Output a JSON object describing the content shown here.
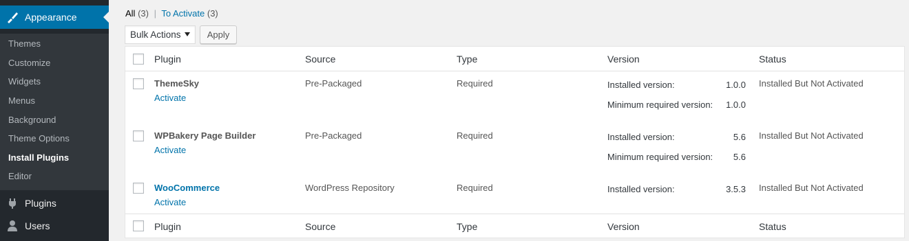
{
  "sidebar": {
    "appearance_label": "Appearance",
    "submenu": [
      "Themes",
      "Customize",
      "Widgets",
      "Menus",
      "Background",
      "Theme Options",
      "Install Plugins",
      "Editor"
    ],
    "current_item": "Install Plugins",
    "plugins_label": "Plugins",
    "users_label": "Users",
    "colors": {
      "bg": "#23282d",
      "active": "#0073aa",
      "submenu_bg": "#32373c"
    }
  },
  "filters": {
    "all_label": "All",
    "all_count": "(3)",
    "to_activate_label": "To Activate",
    "to_activate_count": "(3)"
  },
  "bulk": {
    "select_value": "Bulk Actions",
    "apply_label": "Apply"
  },
  "table": {
    "headers": {
      "plugin": "Plugin",
      "source": "Source",
      "type": "Type",
      "version": "Version",
      "status": "Status"
    },
    "rows": [
      {
        "name": "ThemeSky",
        "action": "Activate",
        "source": "Pre-Packaged",
        "type": "Required",
        "installed_label": "Installed version:",
        "installed_value": "1.0.0",
        "min_label": "Minimum required version:",
        "min_value": "1.0.0",
        "status": "Installed But Not Activated"
      },
      {
        "name": "WPBakery Page Builder",
        "action": "Activate",
        "source": "Pre-Packaged",
        "type": "Required",
        "installed_label": "Installed version:",
        "installed_value": "5.6",
        "min_label": "Minimum required version:",
        "min_value": "5.6",
        "status": "Installed But Not Activated"
      },
      {
        "name": "WooCommerce",
        "action": "Activate",
        "source": "WordPress Repository",
        "type": "Required",
        "installed_label": "Installed version:",
        "installed_value": "3.5.3",
        "status": "Installed But Not Activated"
      }
    ]
  },
  "icons": {
    "appearance": "paintbrush-icon",
    "plugins": "plugin-icon",
    "users": "users-icon"
  }
}
